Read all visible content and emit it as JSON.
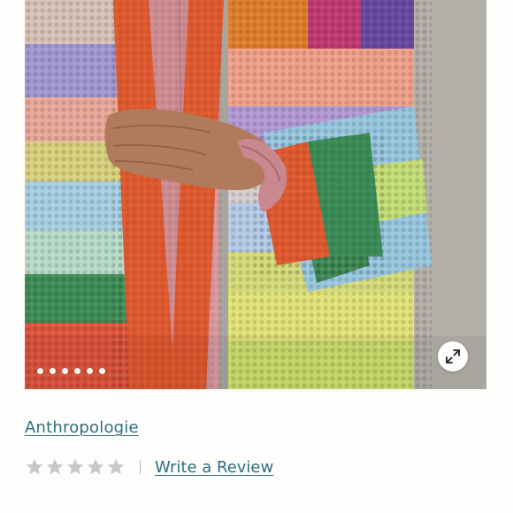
{
  "product": {
    "brand_label": "Anthropologie",
    "review_link_label": "Write a Review",
    "rating": {
      "value": 0,
      "max": 5,
      "star_color_empty": "#c8c8c8"
    }
  },
  "gallery": {
    "image_count": 6,
    "active_index": 0,
    "expand_icon": "expand-arrows-icon"
  },
  "colors": {
    "link": "#2f6f82"
  }
}
